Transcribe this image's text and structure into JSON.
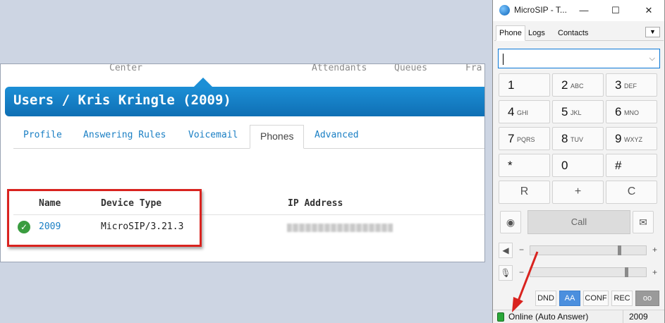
{
  "portal": {
    "topnav": [
      "Center",
      "Attendants",
      "Queues",
      "Fra"
    ],
    "breadcrumb": "Users / Kris Kringle (2009)",
    "tabs": [
      {
        "label": "Profile",
        "active": false
      },
      {
        "label": "Answering Rules",
        "active": false
      },
      {
        "label": "Voicemail",
        "active": false
      },
      {
        "label": "Phones",
        "active": true
      },
      {
        "label": "Advanced",
        "active": false
      }
    ],
    "table": {
      "headers": [
        "Name",
        "Device Type",
        "IP Address"
      ],
      "rows": [
        {
          "name": "2009",
          "device_type": "MicroSIP/3.21.3",
          "status_icon": "check-circle-icon"
        }
      ]
    },
    "colors": {
      "banner": "#1c8fd6",
      "link": "#1a7fc4",
      "highlight": "#d9231f",
      "status_ok": "#3a9c3f"
    }
  },
  "microsip": {
    "title": "MicroSIP - T...",
    "tabs": [
      "Phone",
      "Logs",
      "Contacts"
    ],
    "dial_value": "",
    "keys": [
      {
        "num": "1",
        "sub": ""
      },
      {
        "num": "2",
        "sub": "ABC"
      },
      {
        "num": "3",
        "sub": "DEF"
      },
      {
        "num": "4",
        "sub": "GHI"
      },
      {
        "num": "5",
        "sub": "JKL"
      },
      {
        "num": "6",
        "sub": "MNO"
      },
      {
        "num": "7",
        "sub": "PQRS"
      },
      {
        "num": "8",
        "sub": "TUV"
      },
      {
        "num": "9",
        "sub": "WXYZ"
      },
      {
        "num": "*",
        "sub": ""
      },
      {
        "num": "0",
        "sub": ""
      },
      {
        "num": "#",
        "sub": ""
      }
    ],
    "function_keys": [
      "R",
      "+",
      "C"
    ],
    "call_label": "Call",
    "speaker_level": 0.77,
    "mic_level": 0.83,
    "minus": "−",
    "plus": "+",
    "toggles": [
      {
        "label": "DND",
        "active": false
      },
      {
        "label": "AA",
        "active": true
      },
      {
        "label": "CONF",
        "active": false
      },
      {
        "label": "REC",
        "active": false
      }
    ],
    "status": "Online (Auto Answer)",
    "extension": "2009",
    "colors": {
      "accent": "#4b8fde",
      "online": "#2ba83a"
    }
  }
}
